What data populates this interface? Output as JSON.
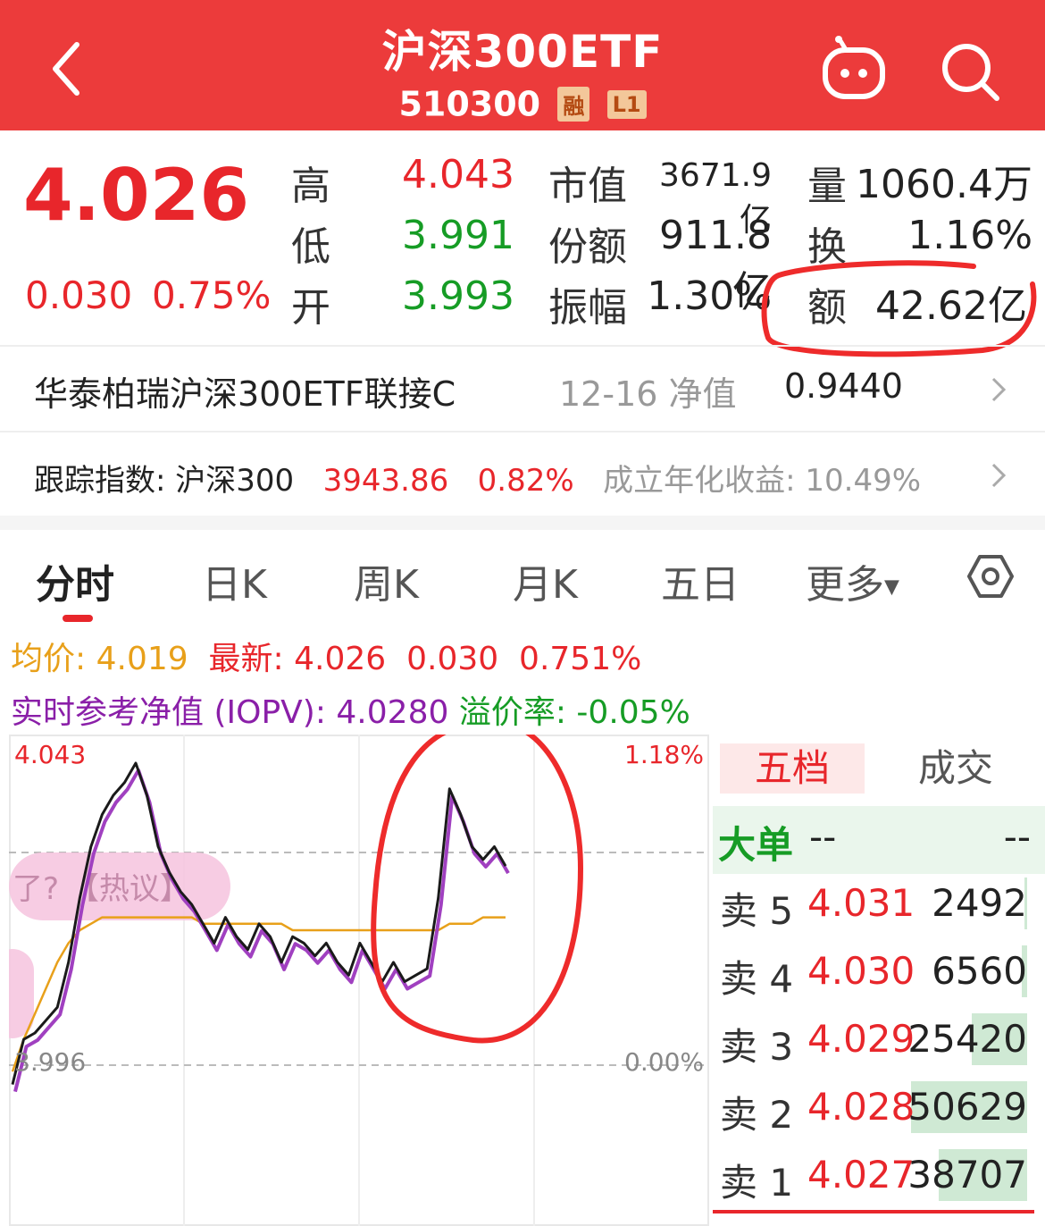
{
  "header": {
    "title": "沪深300ETF",
    "code": "510300",
    "badge_margin": "融",
    "badge_level": "L1",
    "icons": [
      "back-icon",
      "robot-icon",
      "search-icon"
    ]
  },
  "quote": {
    "price": "4.026",
    "change": "0.030",
    "change_pct": "0.75%",
    "high_label": "高",
    "high": "4.043",
    "low_label": "低",
    "low": "3.991",
    "open_label": "开",
    "open": "3.993",
    "mktcap_label": "市值",
    "mktcap": "3671.9亿",
    "shares_label": "份额",
    "shares": "911.8亿",
    "amp_label": "振幅",
    "amp": "1.30%",
    "vol_label": "量",
    "vol": "1060.4万",
    "turn_label": "换",
    "turn": "1.16%",
    "amount_label": "额",
    "amount": "42.62亿"
  },
  "fund": {
    "name": "华泰柏瑞沪深300ETF联接C",
    "nav_label": "12-16 净值",
    "nav": "0.9440"
  },
  "tracking": {
    "label": "跟踪指数: 沪深300",
    "index_value": "3943.86",
    "index_pct": "0.82%",
    "annual_label": "成立年化收益: 10.49%"
  },
  "tabs": [
    "分时",
    "日K",
    "周K",
    "月K",
    "五日",
    "更多"
  ],
  "active_tab": 0,
  "chart_info": {
    "avg_label": "均价:",
    "avg": "4.019",
    "latest_label": "最新:",
    "latest": "4.026",
    "latest_chg": "0.030",
    "latest_pct": "0.751%",
    "iopv_label": "实时参考净值 (IOPV):",
    "iopv": "4.0280",
    "premium_label": "溢价率:",
    "premium": "-0.05%"
  },
  "chart_labels": {
    "top_left": "4.043",
    "bottom_left": "3.996",
    "top_right": "1.18%",
    "bottom_right": "0.00%",
    "overlay_text": "了?  【热议】"
  },
  "chart_data": {
    "type": "line",
    "y_range": [
      3.996,
      4.043
    ],
    "series": [
      {
        "name": "",
        "values": [
          3.993,
          4.0,
          4.001,
          4.003,
          4.005,
          4.012,
          4.022,
          4.03,
          4.035,
          4.038,
          4.04,
          4.043,
          4.038,
          4.03,
          4.026,
          4.023,
          4.021,
          4.018,
          4.015,
          4.019,
          4.016,
          4.014,
          4.018,
          4.016,
          4.012,
          4.016,
          4.015,
          4.013,
          4.015,
          4.012,
          4.01,
          4.015,
          4.012,
          4.009,
          4.012,
          4.009,
          4.01,
          4.011,
          4.022,
          4.039,
          4.035,
          4.03,
          4.028,
          4.03,
          4.027
        ]
      },
      {
        "name": "",
        "values": [
          3.995,
          4.0,
          4.004,
          4.008,
          4.012,
          4.015,
          4.017,
          4.018,
          4.019,
          4.019,
          4.019,
          4.019,
          4.019,
          4.019,
          4.019,
          4.019,
          4.019,
          4.018,
          4.018,
          4.018,
          4.018,
          4.018,
          4.018,
          4.018,
          4.018,
          4.017,
          4.017,
          4.017,
          4.017,
          4.017,
          4.017,
          4.017,
          4.017,
          4.017,
          4.017,
          4.017,
          4.017,
          4.017,
          4.017,
          4.018,
          4.018,
          4.018,
          4.019,
          4.019,
          4.019
        ]
      }
    ]
  },
  "orderbook": {
    "tab_a": "五档",
    "tab_b": "成交",
    "big_label": "大单",
    "big_v1": "--",
    "big_v2": "--",
    "rows": [
      {
        "label": "卖 5",
        "price": "4.031",
        "qty": "2492",
        "fill": 0.02
      },
      {
        "label": "卖 4",
        "price": "4.030",
        "qty": "6560",
        "fill": 0.05
      },
      {
        "label": "卖 3",
        "price": "4.029",
        "qty": "25420",
        "fill": 0.48
      },
      {
        "label": "卖 2",
        "price": "4.028",
        "qty": "50629",
        "fill": 1.0
      },
      {
        "label": "卖 1",
        "price": "4.027",
        "qty": "38707",
        "fill": 0.76
      }
    ]
  }
}
